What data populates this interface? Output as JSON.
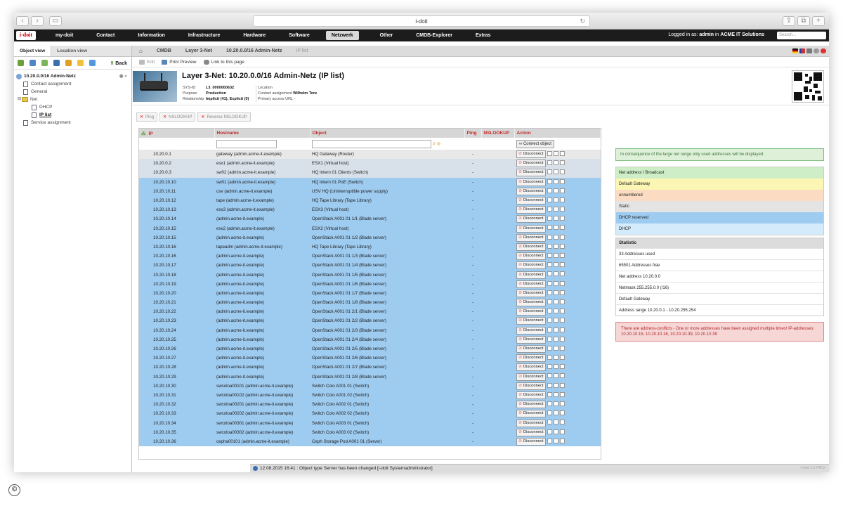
{
  "browser": {
    "title": "i-doit"
  },
  "topnav": {
    "logo": "i-doit",
    "items": [
      "my-doit",
      "Contact",
      "Information",
      "Infrastructure",
      "Hardware",
      "Software",
      "Netzwerk",
      "Other",
      "CMDB-Explorer",
      "Extras"
    ],
    "logged_prefix": "Logged in as:",
    "user": "admin",
    "in_word": "in",
    "org": "ACME IT Solutions",
    "search_placeholder": "Search..."
  },
  "sidebar": {
    "tabs": [
      "Object view",
      "Location view"
    ],
    "back": "Back",
    "tree": {
      "root": "10.20.0.0/16 Admin-Netz",
      "items": [
        "Contact assignment",
        "General",
        "Net",
        "DHCP",
        "IP list",
        "Service assignment"
      ]
    }
  },
  "breadcrumb": [
    "CMDB",
    "Layer 3-Net",
    "10.20.0.0/16 Admin-Netz",
    "IP list"
  ],
  "toolbar": {
    "edit": "Edit",
    "print": "Print Preview",
    "link": "Link to this page"
  },
  "object": {
    "title": "Layer 3-Net: 10.20.0.0/16 Admin-Netz (IP list)",
    "sysid_label": "SYS-ID",
    "sysid": "L3_0000000632",
    "purpose_label": "Purpose",
    "purpose": "Production",
    "relationship_label": "Relationship",
    "relationship": "Implicit (41), Explicit (0)",
    "location_label": "Location",
    "contact_label": "Contact assignment",
    "contact": "Wilhelm Tore",
    "url_label": "Primary access URL",
    "url": "-"
  },
  "actions": {
    "ping": "Ping",
    "nslookup": "NSLOOKUP",
    "reverse": "Reverse NSLOOKUP"
  },
  "table": {
    "headers": [
      "IP",
      "Hostname",
      "Object",
      "Ping",
      "NSLOOKUP",
      "Action"
    ],
    "connect": "Connect object",
    "disconnect": "Disconnect",
    "rows": [
      {
        "ip": "10.20.0.1",
        "host": "gateway (admin.acme-it.example)",
        "obj": "HQ Gateway (Router)",
        "ping": "-",
        "type": "gw"
      },
      {
        "ip": "10.20.0.2",
        "host": "esx1 (admin.acme-it.example)",
        "obj": "ESX1 (Virtual host)",
        "ping": "-",
        "type": "st"
      },
      {
        "ip": "10.20.0.3",
        "host": "sw02 (admin.acme-it.example)",
        "obj": "HQ Intern 01 Clients (Switch)",
        "ping": "-",
        "type": "st"
      },
      {
        "ip": "10.20.10.10",
        "host": "sw01 (admin.acme-it.example)",
        "obj": "HQ Intern 01 PoE (Switch)",
        "ping": "-",
        "type": "dr"
      },
      {
        "ip": "10.20.10.11",
        "host": "usv (admin.acme-it.example)",
        "obj": "USV HQ (Uninterruptible power supply)",
        "ping": "-",
        "type": "dr"
      },
      {
        "ip": "10.20.10.12",
        "host": "tape (admin.acme-it.example)",
        "obj": "HQ Tape Library (Tape Library)",
        "ping": "-",
        "type": "dr"
      },
      {
        "ip": "10.20.10.13",
        "host": "esx3 (admin.acme-it.example)",
        "obj": "ESX3 (Virtual host)",
        "ping": "-",
        "type": "dr"
      },
      {
        "ip": "10.20.10.14",
        "host": "(admin.acme-it.example)",
        "obj": "OpenStack A001 01 1/1 (Blade server)",
        "ping": "-",
        "type": "dr"
      },
      {
        "ip": "10.20.10.15",
        "host": "esx2 (admin.acme-it.example)",
        "obj": "ESX2 (Virtual host)",
        "ping": "-",
        "type": "dr"
      },
      {
        "ip": "10.20.10.15",
        "host": "(admin.acme-it.example)",
        "obj": "OpenStack A001 01 1/2 (Blade server)",
        "ping": "-",
        "type": "dr"
      },
      {
        "ip": "10.20.10.16",
        "host": "tapeadm (admin.acme-it.example)",
        "obj": "HQ Tape Library (Tape Library)",
        "ping": "-",
        "type": "dr"
      },
      {
        "ip": "10.20.10.16",
        "host": "(admin.acme-it.example)",
        "obj": "OpenStack A001 01 1/3 (Blade server)",
        "ping": "-",
        "type": "dr"
      },
      {
        "ip": "10.20.10.17",
        "host": "(admin.acme-it.example)",
        "obj": "OpenStack A001 01 1/4 (Blade server)",
        "ping": "-",
        "type": "dr"
      },
      {
        "ip": "10.20.10.18",
        "host": "(admin.acme-it.example)",
        "obj": "OpenStack A001 01 1/5 (Blade server)",
        "ping": "-",
        "type": "dr"
      },
      {
        "ip": "10.20.10.19",
        "host": "(admin.acme-it.example)",
        "obj": "OpenStack A001 01 1/6 (Blade server)",
        "ping": "-",
        "type": "dr"
      },
      {
        "ip": "10.20.10.20",
        "host": "(admin.acme-it.example)",
        "obj": "OpenStack A001 01 1/7 (Blade server)",
        "ping": "-",
        "type": "dr"
      },
      {
        "ip": "10.20.10.21",
        "host": "(admin.acme-it.example)",
        "obj": "OpenStack A001 01 1/8 (Blade server)",
        "ping": "-",
        "type": "dr"
      },
      {
        "ip": "10.20.10.22",
        "host": "(admin.acme-it.example)",
        "obj": "OpenStack A001 01 2/1 (Blade server)",
        "ping": "-",
        "type": "dr"
      },
      {
        "ip": "10.20.10.23",
        "host": "(admin.acme-it.example)",
        "obj": "OpenStack A001 01 2/2 (Blade server)",
        "ping": "-",
        "type": "dr"
      },
      {
        "ip": "10.20.10.24",
        "host": "(admin.acme-it.example)",
        "obj": "OpenStack A001 01 2/3 (Blade server)",
        "ping": "-",
        "type": "dr"
      },
      {
        "ip": "10.20.10.25",
        "host": "(admin.acme-it.example)",
        "obj": "OpenStack A001 01 2/4 (Blade server)",
        "ping": "-",
        "type": "dr"
      },
      {
        "ip": "10.20.10.26",
        "host": "(admin.acme-it.example)",
        "obj": "OpenStack A001 01 2/5 (Blade server)",
        "ping": "-",
        "type": "dr"
      },
      {
        "ip": "10.20.10.27",
        "host": "(admin.acme-it.example)",
        "obj": "OpenStack A001 01 2/6 (Blade server)",
        "ping": "-",
        "type": "dr"
      },
      {
        "ip": "10.20.10.28",
        "host": "(admin.acme-it.example)",
        "obj": "OpenStack A001 01 2/7 (Blade server)",
        "ping": "-",
        "type": "dr"
      },
      {
        "ip": "10.20.10.29",
        "host": "(admin.acme-it.example)",
        "obj": "OpenStack A001 01 2/8 (Blade server)",
        "ping": "-",
        "type": "dr"
      },
      {
        "ip": "10.20.10.30",
        "host": "swcoloa00101 (admin.acme-it.example)",
        "obj": "Switch Colo A001 01 (Switch)",
        "ping": "-",
        "type": "dr"
      },
      {
        "ip": "10.20.10.31",
        "host": "swcoloa00102 (admin.acme-it.example)",
        "obj": "Switch Colo A001 02 (Switch)",
        "ping": "-",
        "type": "dr"
      },
      {
        "ip": "10.20.10.32",
        "host": "swcoloa00201 (admin.acme-it.example)",
        "obj": "Switch Colo A002 01 (Switch)",
        "ping": "-",
        "type": "dr"
      },
      {
        "ip": "10.20.10.33",
        "host": "swcoloa00202 (admin.acme-it.example)",
        "obj": "Switch Colo A002 02 (Switch)",
        "ping": "-",
        "type": "dr"
      },
      {
        "ip": "10.20.10.34",
        "host": "swcoloa00301 (admin.acme-it.example)",
        "obj": "Switch Colo A003 01 (Switch)",
        "ping": "-",
        "type": "dr"
      },
      {
        "ip": "10.20.10.35",
        "host": "swcoloa00302 (admin.acme-it.example)",
        "obj": "Switch Colo A003 02 (Switch)",
        "ping": "-",
        "type": "dr"
      },
      {
        "ip": "10.20.10.36",
        "host": "cepha00101 (admin.acme-it.example)",
        "obj": "Ceph Storage Pod A001 01 (Server)",
        "ping": "-",
        "type": "dr"
      }
    ]
  },
  "info": "In consequence of the large net range only used addresses will be displayed.",
  "legend": [
    {
      "label": "Net address / Broadcast",
      "color": "#cdeec6"
    },
    {
      "label": "Default Gateway",
      "color": "#fbf6b4"
    },
    {
      "label": "unnumbered",
      "color": "#fbdcc2"
    },
    {
      "label": "Static",
      "color": "#e4e4e4"
    },
    {
      "label": "DHCP reserved",
      "color": "#9ecbf0"
    },
    {
      "label": "DHCP",
      "color": "#d4ebfb"
    }
  ],
  "statistic": {
    "title": "Statistic",
    "rows": [
      "33 Addresses used",
      "65501 Addresses free",
      "Net address 10.20.0.0",
      "Netmask 255.255.0.0 (/16)",
      "Default Gateway",
      "Address range 10.20.0.1 - 10.20.255.254"
    ]
  },
  "conflict": "There are address-conflicts - One or more addresses have been assigned multiple times! IP-addresses: 10.20.10.15, 10.20.10.16, 10.20.10.39, 10.20.10.39",
  "statusbar": {
    "message": "12.08.2015 16:41 : Object type Server has been changed [i-doit Systemadministrator]",
    "version": "i-doit 1.6 PRO"
  },
  "copyright": "©"
}
